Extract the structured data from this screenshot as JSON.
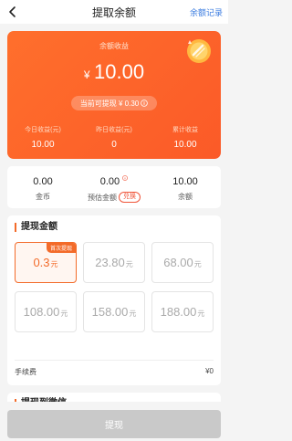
{
  "header": {
    "title": "提取余额",
    "record_link": "余额记录"
  },
  "card": {
    "label": "余额收益",
    "currency": "¥",
    "amount": "10.00",
    "withdrawable": "当前可提现 ¥ 0.30",
    "stats": [
      {
        "label": "今日收益(元)",
        "value": "10.00"
      },
      {
        "label": "昨日收益(元)",
        "value": "0"
      },
      {
        "label": "累计收益",
        "value": "10.00"
      }
    ]
  },
  "summary": {
    "gold": {
      "value": "0.00",
      "label": "金币"
    },
    "estimated": {
      "value": "0.00",
      "label": "预估金额",
      "exchange_label": "兑换"
    },
    "balance": {
      "value": "10.00",
      "label": "余额"
    }
  },
  "withdraw": {
    "section_title": "提现金额",
    "first_tag": "首次提现",
    "unit": "元",
    "options": [
      "0.3",
      "23.80",
      "68.00",
      "108.00",
      "158.00",
      "188.00"
    ],
    "selected_index": 0,
    "fee_label": "手续费",
    "fee_value": "¥0"
  },
  "method": {
    "section_title": "提现到微信"
  },
  "submit_label": "提现",
  "colors": {
    "accent": "#f36b2a",
    "card": "#fb5a28",
    "link": "#3a7be0",
    "disabled_button": "#c9c9c9"
  }
}
